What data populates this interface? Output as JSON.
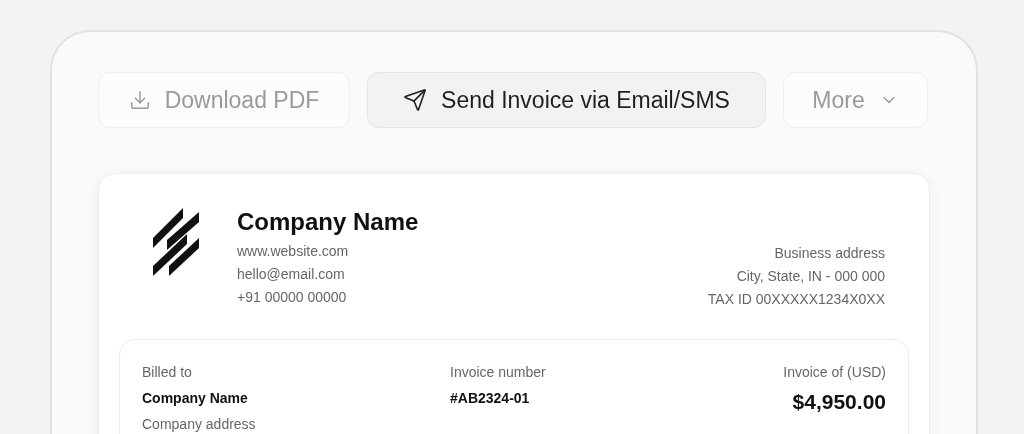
{
  "actions": [
    {
      "kind": "download",
      "label": "Download PDF",
      "disabled": true
    },
    {
      "kind": "send",
      "label": "Send Invoice via Email/SMS",
      "disabled": false
    },
    {
      "kind": "more",
      "label": "More",
      "disabled": true
    }
  ],
  "invoice": {
    "company": {
      "name": "Company Name",
      "website": "www.website.com",
      "email": "hello@email.com",
      "phone": "+91 00000 00000"
    },
    "business": {
      "address": "Business address",
      "city": "City, State, IN - 000 000",
      "tax_id": "TAX ID 00XXXXX1234X0XX"
    },
    "billed_to": {
      "label": "Billed to",
      "name": "Company Name",
      "address": "Company address"
    },
    "invoice_number": {
      "label": "Invoice number",
      "value": "#AB2324-01"
    },
    "amount": {
      "label": "Invoice of (USD)",
      "value": "$4,950.00"
    }
  }
}
